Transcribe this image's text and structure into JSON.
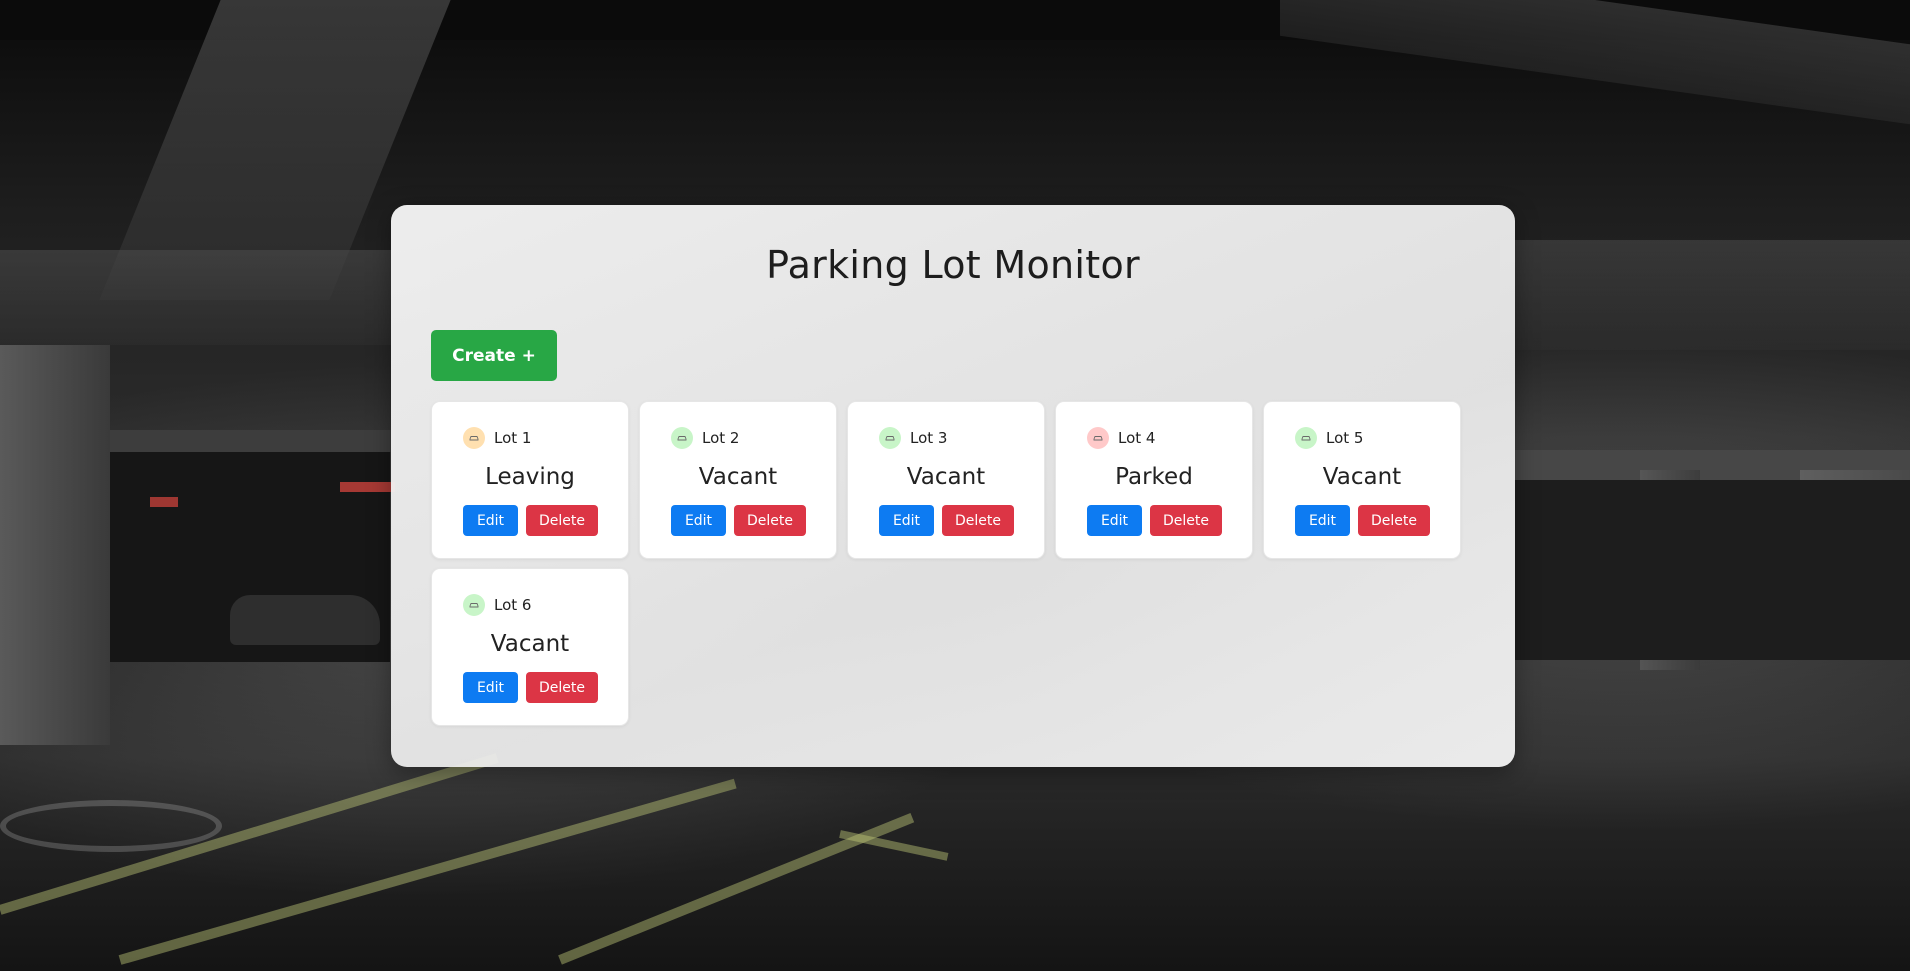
{
  "page": {
    "title": "Parking Lot Monitor",
    "create_label": "Create +"
  },
  "colors": {
    "create": "#28a745",
    "edit": "#0d7bf2",
    "delete": "#dc3545",
    "leaving": "#ffe0b0",
    "vacant": "#c8f5c8",
    "parked": "#ffc9c9"
  },
  "lots": [
    {
      "name": "Lot 1",
      "status": "Leaving",
      "indicator": "leaving",
      "icon": "car-icon",
      "edit_label": "Edit",
      "delete_label": "Delete"
    },
    {
      "name": "Lot 2",
      "status": "Vacant",
      "indicator": "vacant",
      "icon": "car-icon",
      "edit_label": "Edit",
      "delete_label": "Delete"
    },
    {
      "name": "Lot 3",
      "status": "Vacant",
      "indicator": "vacant",
      "icon": "car-icon",
      "edit_label": "Edit",
      "delete_label": "Delete"
    },
    {
      "name": "Lot 4",
      "status": "Parked",
      "indicator": "parked",
      "icon": "car-icon",
      "edit_label": "Edit",
      "delete_label": "Delete"
    },
    {
      "name": "Lot 5",
      "status": "Vacant",
      "indicator": "vacant",
      "icon": "car-icon",
      "edit_label": "Edit",
      "delete_label": "Delete"
    },
    {
      "name": "Lot 6",
      "status": "Vacant",
      "indicator": "vacant",
      "icon": "car-icon",
      "edit_label": "Edit",
      "delete_label": "Delete"
    }
  ]
}
